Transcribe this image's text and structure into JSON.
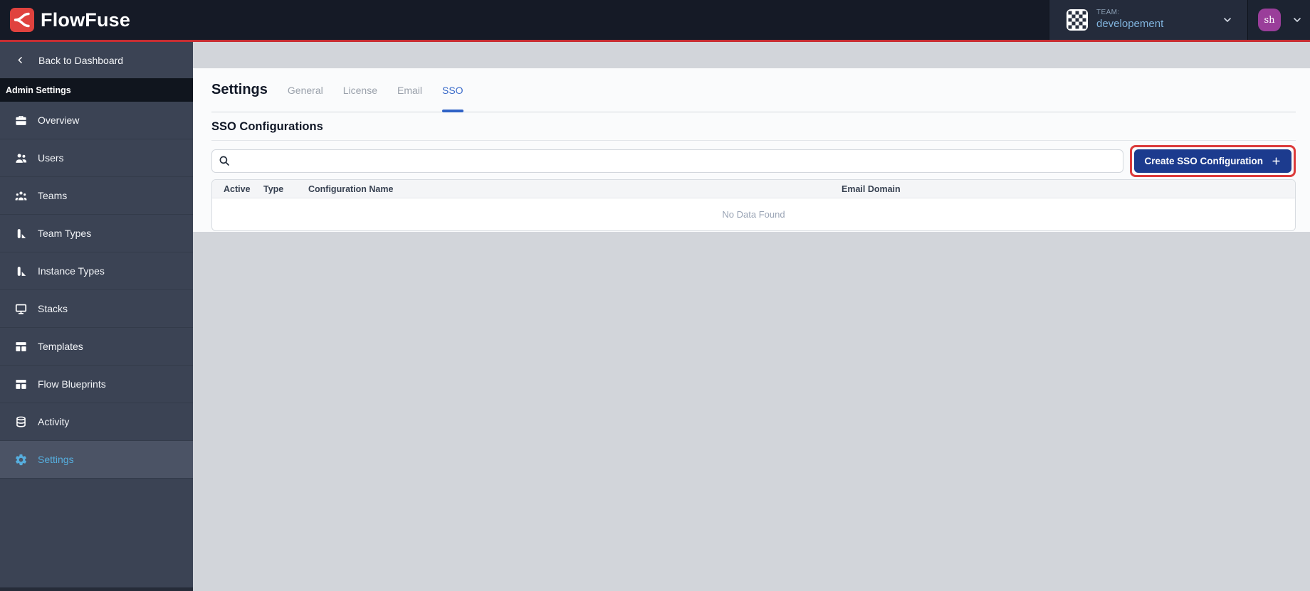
{
  "navbar": {
    "brand": "FlowFuse",
    "team_label": "TEAM:",
    "team_name": "developement",
    "avatar_initials": "sh"
  },
  "sidebar": {
    "back_label": "Back to Dashboard",
    "section_label": "Admin Settings",
    "items": [
      {
        "label": "Overview",
        "active": false
      },
      {
        "label": "Users",
        "active": false
      },
      {
        "label": "Teams",
        "active": false
      },
      {
        "label": "Team Types",
        "active": false
      },
      {
        "label": "Instance Types",
        "active": false
      },
      {
        "label": "Stacks",
        "active": false
      },
      {
        "label": "Templates",
        "active": false
      },
      {
        "label": "Flow Blueprints",
        "active": false
      },
      {
        "label": "Activity",
        "active": false
      },
      {
        "label": "Settings",
        "active": true
      }
    ]
  },
  "page": {
    "title": "Settings",
    "tabs": [
      {
        "label": "General",
        "active": false
      },
      {
        "label": "License",
        "active": false
      },
      {
        "label": "Email",
        "active": false
      },
      {
        "label": "SSO",
        "active": true
      }
    ]
  },
  "sso": {
    "heading": "SSO Configurations",
    "search_placeholder": "",
    "search_value": "",
    "create_button": "Create SSO Configuration",
    "table": {
      "columns": [
        "Active",
        "Type",
        "Configuration Name",
        "Email Domain"
      ],
      "rows": [],
      "empty_text": "No Data Found"
    }
  },
  "colors": {
    "accent_red": "#c72e32",
    "logo_red": "#e0423e",
    "button_navy": "#1c3b8e",
    "tab_active_blue": "#3a6bc9",
    "sidebar_active_blue": "#56aede",
    "annotation_red": "#dc3b3b",
    "avatar_purple": "#9a3e9a"
  }
}
